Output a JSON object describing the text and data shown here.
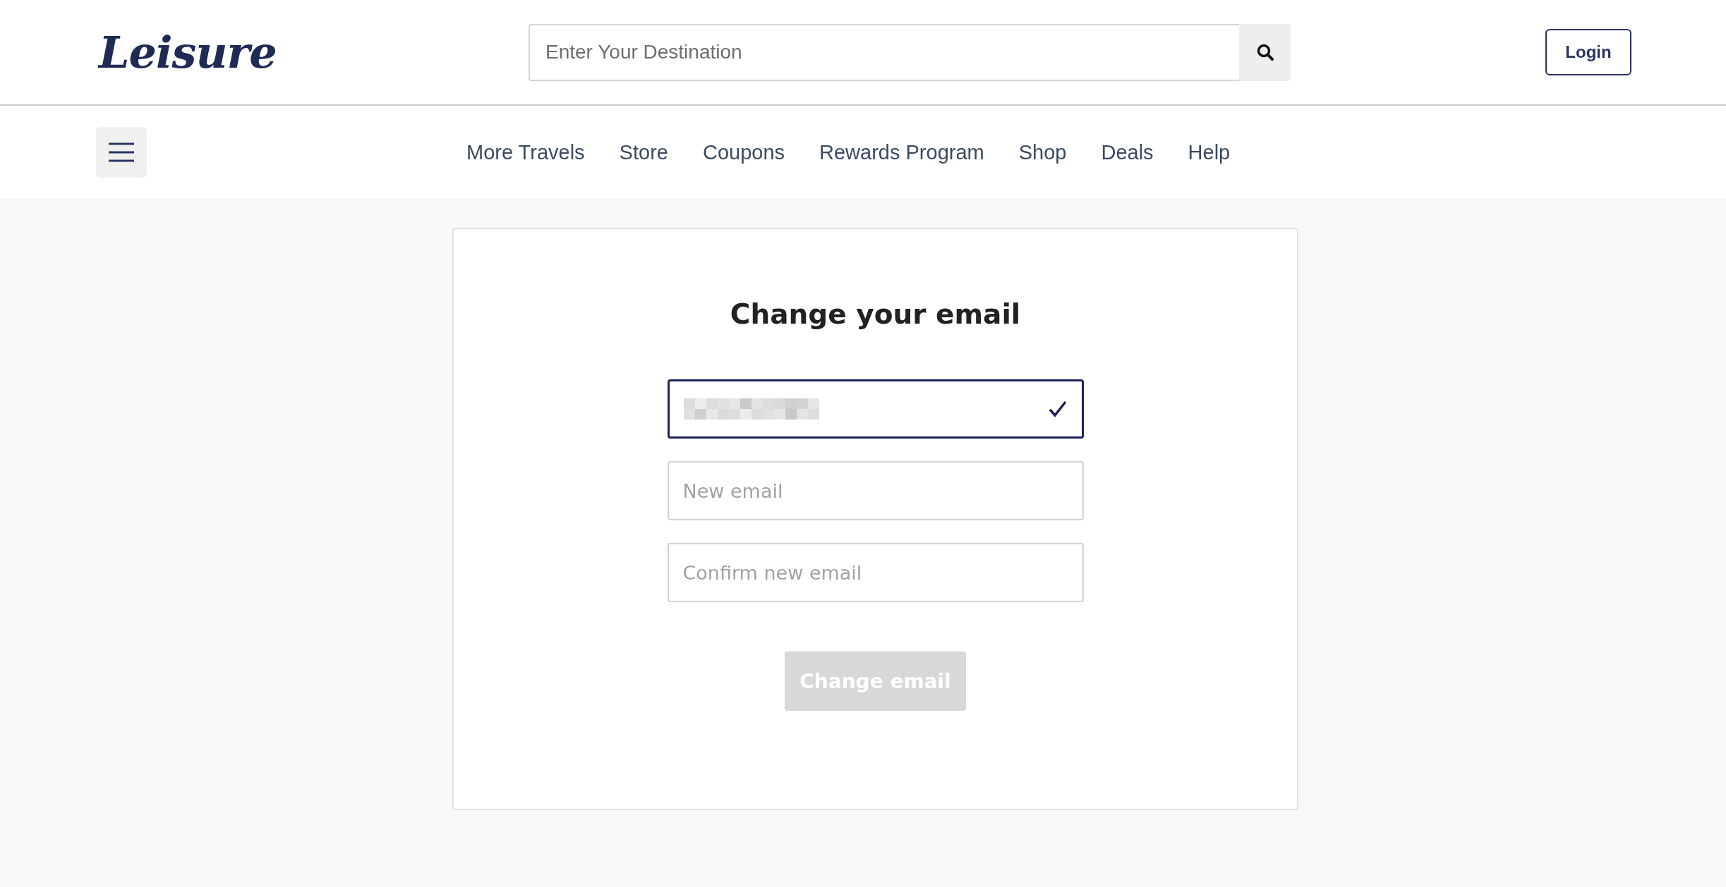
{
  "header": {
    "logo": "Leisure",
    "search": {
      "placeholder": "Enter Your Destination"
    },
    "login": "Login"
  },
  "nav": {
    "items": [
      "More Travels",
      "Store",
      "Coupons",
      "Rewards Program",
      "Shop",
      "Deals",
      "Help"
    ]
  },
  "form": {
    "title": "Change your email",
    "fields": [
      {
        "kind": "current",
        "valid": true
      },
      {
        "kind": "input",
        "placeholder": "New email",
        "valid": false
      },
      {
        "kind": "input",
        "placeholder": "Confirm new email",
        "valid": false
      }
    ],
    "submit": {
      "label": "Change email",
      "disabled": true
    }
  }
}
